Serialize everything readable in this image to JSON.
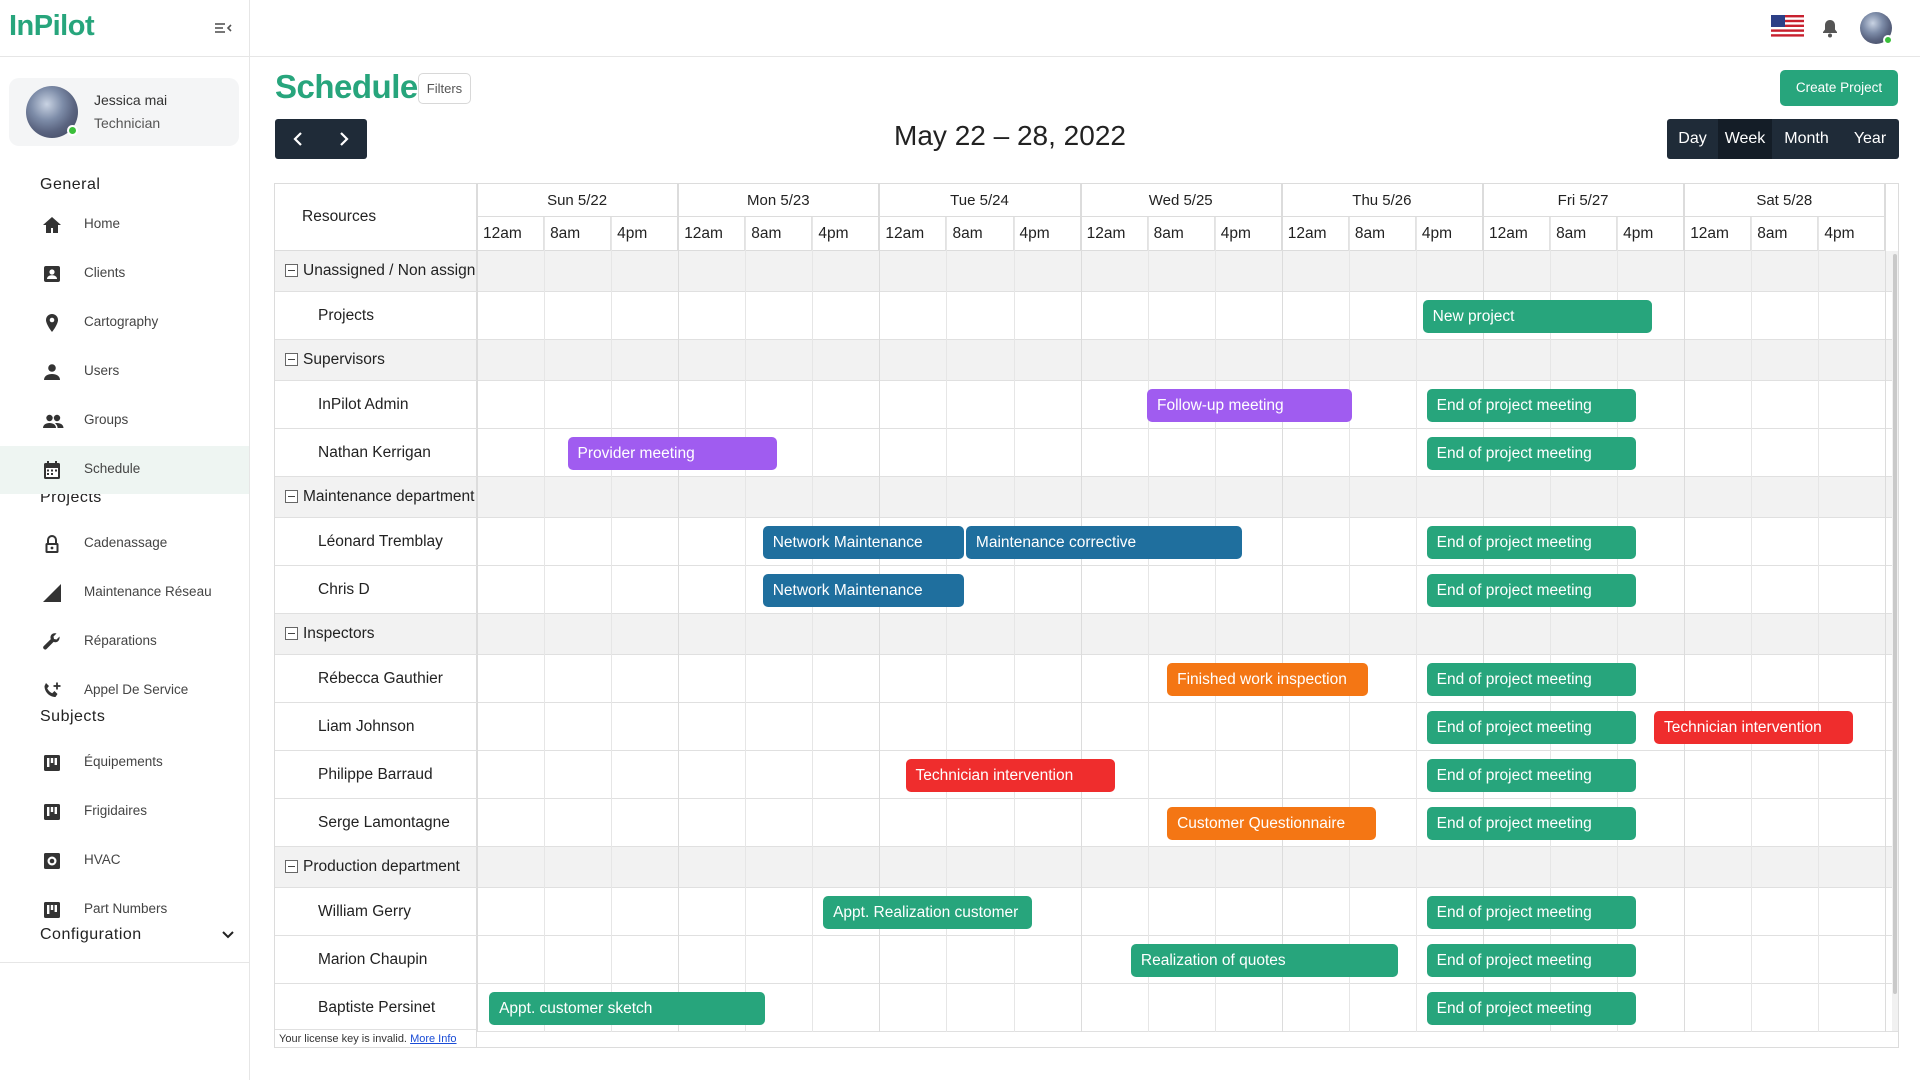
{
  "app": {
    "name": "InPilot"
  },
  "user": {
    "name": "Jessica mai",
    "role": "Technician"
  },
  "sidebar": {
    "sections": {
      "general": "General",
      "projects": "Projects",
      "subjects": "Subjects",
      "configuration": "Configuration"
    },
    "general_items": [
      {
        "label": "Home",
        "icon": "home-icon"
      },
      {
        "label": "Clients",
        "icon": "id-card-icon"
      },
      {
        "label": "Cartography",
        "icon": "map-pin-icon"
      },
      {
        "label": "Users",
        "icon": "user-icon"
      },
      {
        "label": "Groups",
        "icon": "group-icon"
      },
      {
        "label": "Schedule",
        "icon": "calendar-icon",
        "active": true
      }
    ],
    "project_items": [
      {
        "label": "Cadenassage",
        "icon": "lock-icon"
      },
      {
        "label": "Maintenance Réseau",
        "icon": "signal-icon"
      },
      {
        "label": "Réparations",
        "icon": "wrench-icon"
      },
      {
        "label": "Appel De Service",
        "icon": "phone-add-icon"
      }
    ],
    "subject_items": [
      {
        "label": "Équipements",
        "icon": "board-icon"
      },
      {
        "label": "Frigidaires",
        "icon": "board-icon"
      },
      {
        "label": "HVAC",
        "icon": "hvac-icon"
      },
      {
        "label": "Part Numbers",
        "icon": "board-icon"
      }
    ]
  },
  "header": {
    "title": "Schedule",
    "filters_label": "Filters",
    "create_label": "Create Project",
    "date_range": "May 22 – 28, 2022",
    "views": [
      "Day",
      "Week",
      "Month",
      "Year"
    ],
    "active_view": "Week"
  },
  "scheduler": {
    "resources_header": "Resources",
    "days": [
      "Sun 5/22",
      "Mon 5/23",
      "Tue 5/24",
      "Wed 5/25",
      "Thu 5/26",
      "Fri 5/27",
      "Sat 5/28"
    ],
    "hours": [
      "12am",
      "8am",
      "4pm"
    ],
    "rows": [
      {
        "type": "group",
        "label": "Unassigned / Non assigned"
      },
      {
        "type": "resource",
        "label": "Projects"
      },
      {
        "type": "group",
        "label": "Supervisors"
      },
      {
        "type": "resource",
        "label": "InPilot Admin"
      },
      {
        "type": "resource",
        "label": "Nathan Kerrigan"
      },
      {
        "type": "group",
        "label": "Maintenance department"
      },
      {
        "type": "resource",
        "label": "Léonard Tremblay"
      },
      {
        "type": "resource",
        "label": "Chris D"
      },
      {
        "type": "group",
        "label": "Inspectors"
      },
      {
        "type": "resource",
        "label": "Rébecca Gauthier"
      },
      {
        "type": "resource",
        "label": "Liam Johnson"
      },
      {
        "type": "resource",
        "label": "Philippe Barraud"
      },
      {
        "type": "resource",
        "label": "Serge Lamontagne"
      },
      {
        "type": "group",
        "label": "Production department"
      },
      {
        "type": "resource",
        "label": "William Gerry"
      },
      {
        "type": "resource",
        "label": "Marion Chaupin"
      },
      {
        "type": "resource",
        "label": "Baptiste Persinet"
      }
    ],
    "colors": {
      "green": "#27a57c",
      "purple": "#a05cf0",
      "blue": "#1f6f9e",
      "orange": "#f47614",
      "red": "#ef2d2d"
    },
    "events": [
      {
        "row": 1,
        "label": "New project",
        "color": "green",
        "start_day": 4.7,
        "end_day": 5.84
      },
      {
        "row": 3,
        "label": "Follow-up meeting",
        "color": "purple",
        "start_day": 3.33,
        "end_day": 4.35
      },
      {
        "row": 3,
        "label": "End of project meeting",
        "color": "green",
        "start_day": 4.72,
        "end_day": 5.76
      },
      {
        "row": 4,
        "label": "Provider meeting",
        "color": "purple",
        "start_day": 0.45,
        "end_day": 1.49
      },
      {
        "row": 4,
        "label": "End of project meeting",
        "color": "green",
        "start_day": 4.72,
        "end_day": 5.76
      },
      {
        "row": 6,
        "label": "Network Maintenance",
        "color": "blue",
        "start_day": 1.42,
        "end_day": 2.42
      },
      {
        "row": 6,
        "label": "Maintenance corrective",
        "color": "blue",
        "start_day": 2.43,
        "end_day": 3.8
      },
      {
        "row": 6,
        "label": "End of project meeting",
        "color": "green",
        "start_day": 4.72,
        "end_day": 5.76
      },
      {
        "row": 7,
        "label": "Network Maintenance",
        "color": "blue",
        "start_day": 1.42,
        "end_day": 2.42
      },
      {
        "row": 7,
        "label": "End of project meeting",
        "color": "green",
        "start_day": 4.72,
        "end_day": 5.76
      },
      {
        "row": 9,
        "label": "Finished work inspection",
        "color": "orange",
        "start_day": 3.43,
        "end_day": 4.43
      },
      {
        "row": 9,
        "label": "End of project meeting",
        "color": "green",
        "start_day": 4.72,
        "end_day": 5.76
      },
      {
        "row": 10,
        "label": "End of project meeting",
        "color": "green",
        "start_day": 4.72,
        "end_day": 5.76
      },
      {
        "row": 10,
        "label": "Technician intervention",
        "color": "red",
        "start_day": 5.85,
        "end_day": 6.84
      },
      {
        "row": 11,
        "label": "Technician intervention",
        "color": "red",
        "start_day": 2.13,
        "end_day": 3.17
      },
      {
        "row": 11,
        "label": "End of project meeting",
        "color": "green",
        "start_day": 4.72,
        "end_day": 5.76
      },
      {
        "row": 12,
        "label": "Customer Questionnaire",
        "color": "orange",
        "start_day": 3.43,
        "end_day": 4.47
      },
      {
        "row": 12,
        "label": "End of project meeting",
        "color": "green",
        "start_day": 4.72,
        "end_day": 5.76
      },
      {
        "row": 14,
        "label": "Appt. Realization customer",
        "color": "green",
        "start_day": 1.72,
        "end_day": 2.76
      },
      {
        "row": 14,
        "label": "End of project meeting",
        "color": "green",
        "start_day": 4.72,
        "end_day": 5.76
      },
      {
        "row": 15,
        "label": "Realization of quotes",
        "color": "green",
        "start_day": 3.25,
        "end_day": 4.58
      },
      {
        "row": 15,
        "label": "End of project meeting",
        "color": "green",
        "start_day": 4.72,
        "end_day": 5.76
      },
      {
        "row": 16,
        "label": "Appt. customer sketch",
        "color": "green",
        "start_day": 0.06,
        "end_day": 1.43
      },
      {
        "row": 16,
        "label": "End of project meeting",
        "color": "green",
        "start_day": 4.72,
        "end_day": 5.76
      }
    ],
    "license_text": "Your license key is invalid.",
    "license_link": "More Info"
  }
}
